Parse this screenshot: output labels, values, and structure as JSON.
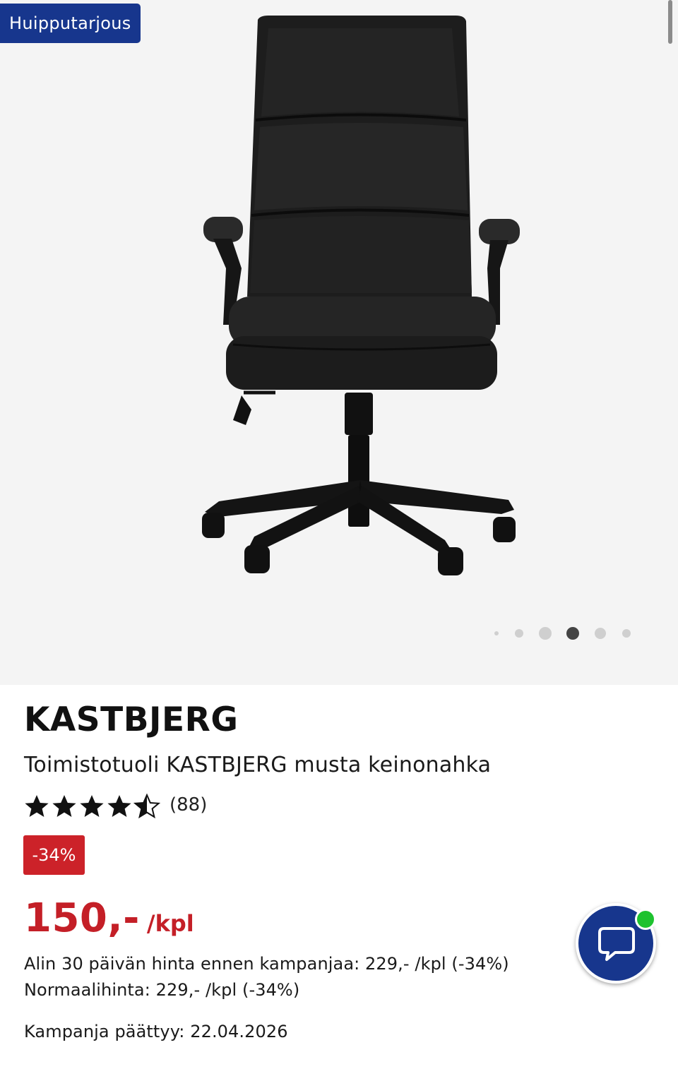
{
  "gallery": {
    "badge": "Huipputarjous",
    "dots": {
      "count": 6,
      "active_index": 3
    }
  },
  "product": {
    "brand": "KASTBJERG",
    "subtitle": "Toimistotuoli KASTBJERG musta keinonahka",
    "rating": {
      "stars": 4.5,
      "max": 5,
      "count_label": "(88)"
    },
    "discount_badge": "-34%",
    "price": "150,-",
    "price_unit": "/kpl",
    "lowest_price_note": "Alin 30 päivän hinta ennen kampanjaa: 229,- /kpl (-34%)",
    "normal_price_note": "Normaalihinta: 229,- /kpl (-34%)",
    "campaign_end_note": "Kampanja päättyy: 22.04.2026"
  },
  "colors": {
    "brand_blue": "#17368d",
    "price_red": "#c41f27",
    "discount_red": "#cc2229",
    "online_green": "#1ec22f"
  },
  "chat": {
    "icon": "chat-bubble-icon",
    "status": "online"
  }
}
